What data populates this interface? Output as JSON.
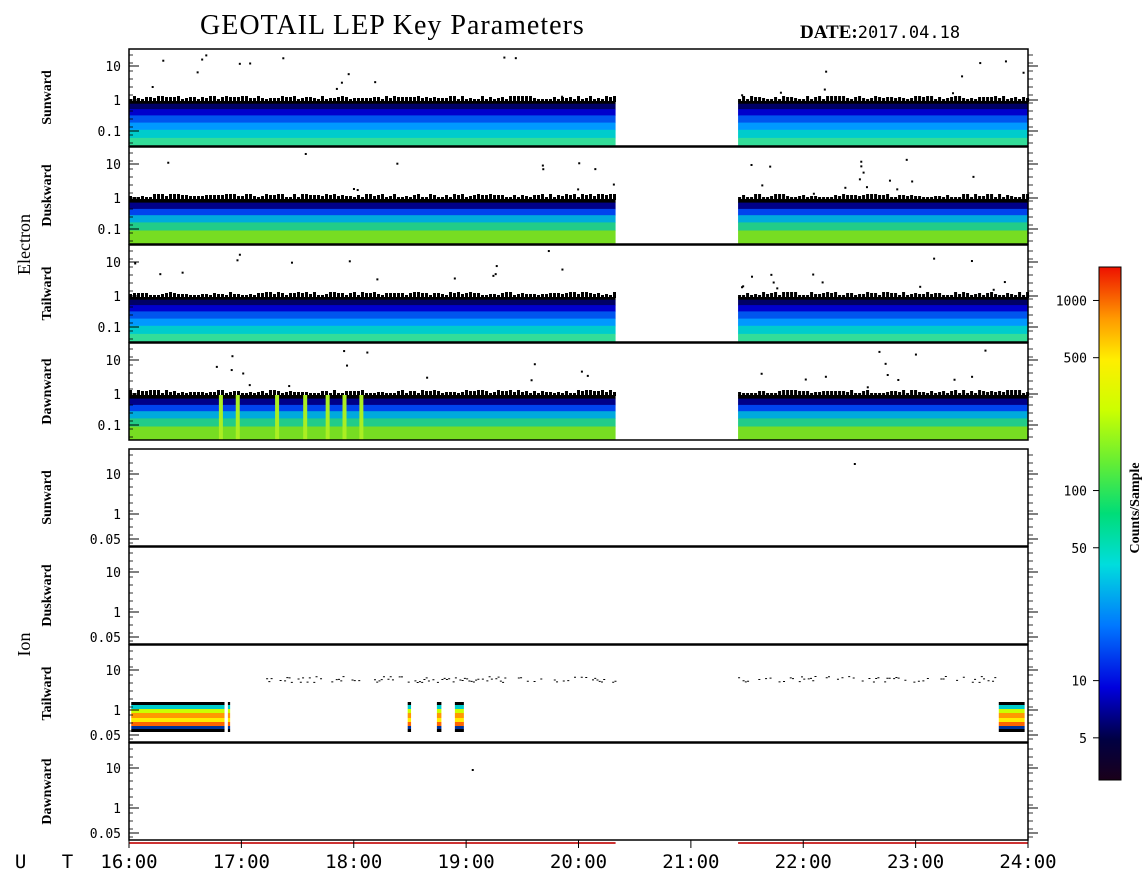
{
  "header": {
    "title": "GEOTAIL LEP Key Parameters",
    "date_label": "DATE:",
    "date_value": "2017.04.18"
  },
  "chart_data": {
    "type": "heatmap",
    "x_axis": {
      "prefix": "U T",
      "ticks": [
        "16:00",
        "17:00",
        "18:00",
        "19:00",
        "20:00",
        "21:00",
        "22:00",
        "23:00",
        "24:00"
      ],
      "range_hours": [
        16,
        24
      ]
    },
    "groups": [
      {
        "name": "Electron",
        "panels": [
          {
            "label": "Sunward",
            "yticks": [
              "10",
              "1",
              "0.1"
            ]
          },
          {
            "label": "Duskward",
            "yticks": [
              "10",
              "1",
              "0.1"
            ]
          },
          {
            "label": "Tailward",
            "yticks": [
              "10",
              "1",
              "0.1"
            ]
          },
          {
            "label": "Dawnward",
            "yticks": [
              "10",
              "1",
              "0.1"
            ]
          }
        ]
      },
      {
        "name": "Ion",
        "panels": [
          {
            "label": "Sunward",
            "yticks": [
              "10",
              "1",
              "0.05"
            ]
          },
          {
            "label": "Duskward",
            "yticks": [
              "10",
              "1",
              "0.05"
            ]
          },
          {
            "label": "Tailward",
            "yticks": [
              "10",
              "1",
              "0.05"
            ]
          },
          {
            "label": "Dawnward",
            "yticks": [
              "10",
              "1",
              "0.05"
            ]
          }
        ]
      }
    ],
    "data_gap_hours": [
      20.33,
      21.42
    ],
    "electron_coverage_hours": [
      [
        16.0,
        20.33
      ],
      [
        21.42,
        24.0
      ]
    ],
    "ion_tailward_bursts_hours": [
      16.0,
      16.9,
      18.5,
      18.75,
      18.9,
      19.0,
      23.75
    ],
    "colorbar": {
      "label": "Counts/Sample",
      "scale": "log",
      "range": [
        3,
        1500
      ],
      "ticks": [
        "1000",
        "500",
        "100",
        "50",
        "10",
        "5"
      ],
      "tick_values": [
        1000,
        500,
        100,
        50,
        10,
        5
      ]
    }
  }
}
